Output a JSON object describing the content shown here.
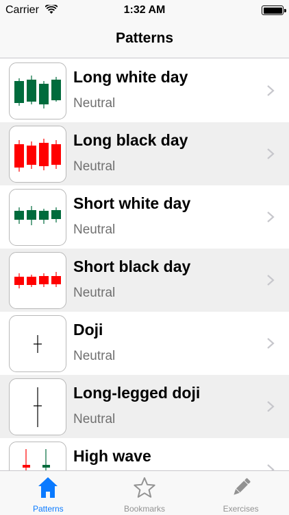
{
  "status_bar": {
    "carrier": "Carrier",
    "time": "1:32 AM"
  },
  "nav": {
    "title": "Patterns"
  },
  "list": [
    {
      "title": "Long white day",
      "subtitle": "Neutral",
      "icon": "long-white-day-pattern"
    },
    {
      "title": "Long black day",
      "subtitle": "Neutral",
      "icon": "long-black-day-pattern"
    },
    {
      "title": "Short white day",
      "subtitle": "Neutral",
      "icon": "short-white-day-pattern"
    },
    {
      "title": "Short black day",
      "subtitle": "Neutral",
      "icon": "short-black-day-pattern"
    },
    {
      "title": "Doji",
      "subtitle": "Neutral",
      "icon": "doji-pattern"
    },
    {
      "title": "Long-legged doji",
      "subtitle": "Neutral",
      "icon": "long-legged-doji-pattern"
    },
    {
      "title": "High wave",
      "subtitle": "",
      "icon": "high-wave-pattern"
    }
  ],
  "tabs": [
    {
      "label": "Patterns",
      "icon": "home-icon",
      "active": true
    },
    {
      "label": "Bookmarks",
      "icon": "star-icon",
      "active": false
    },
    {
      "label": "Exercises",
      "icon": "pencil-icon",
      "active": false
    }
  ],
  "colors": {
    "bullish": "#006b3c",
    "bearish": "#ff0000",
    "accent": "#0a7aff",
    "alt_row": "#efefef"
  }
}
